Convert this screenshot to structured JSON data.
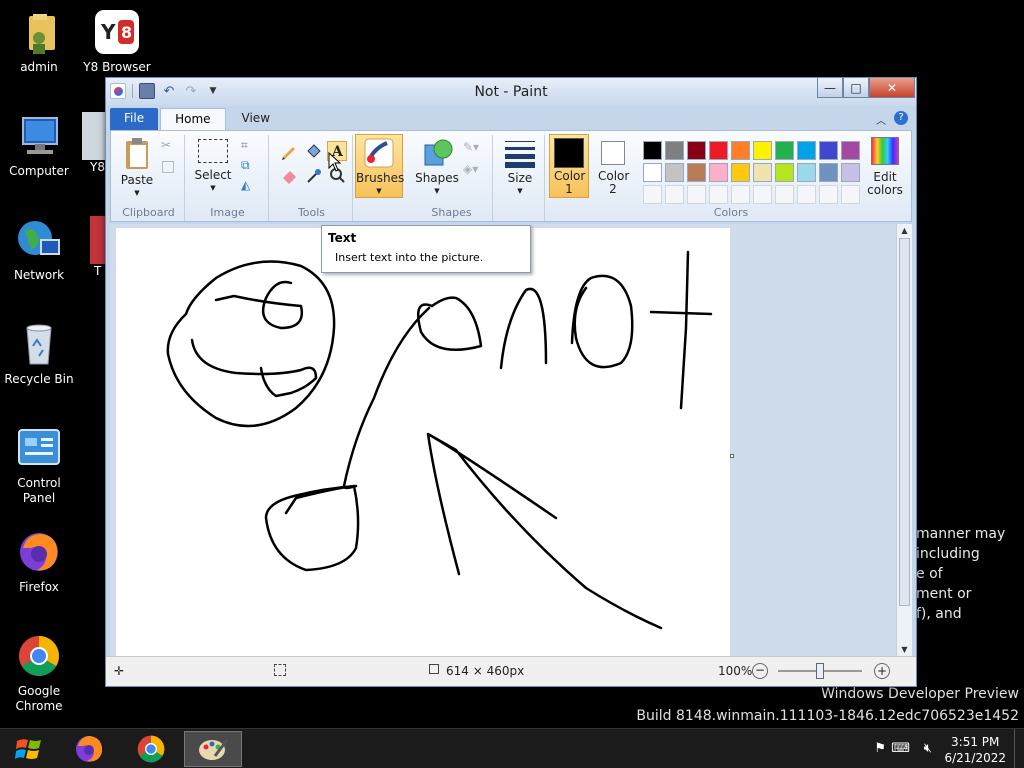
{
  "desktop": {
    "icons": [
      {
        "label": "admin",
        "icon": "user-folder-icon"
      },
      {
        "label": "Y8 Browser",
        "icon": "y8-browser-icon"
      },
      {
        "label": "Computer",
        "icon": "computer-icon"
      },
      {
        "label": "Network",
        "icon": "network-icon"
      },
      {
        "label": "Recycle Bin",
        "icon": "recycle-bin-icon"
      },
      {
        "label": "Control Panel",
        "icon": "control-panel-icon"
      },
      {
        "label": "Firefox",
        "icon": "firefox-icon"
      },
      {
        "label": "Google Chrome",
        "icon": "chrome-icon"
      }
    ],
    "partial_icon_labels": [
      "Y8",
      "T"
    ],
    "background_text": "manner may\nincluding\ne of\nment or\nf), and",
    "watermark": {
      "line1": "Windows Developer Preview",
      "line2": "Build 8148.winmain.111103-1846.12edc706523e1452"
    }
  },
  "window": {
    "title": "Not - Paint",
    "controls": {
      "minimize": "—",
      "maximize": "□",
      "close": "✕"
    },
    "tabs": [
      "File",
      "Home",
      "View"
    ],
    "ribbon": {
      "clipboard": {
        "label": "Clipboard",
        "paste": "Paste"
      },
      "image": {
        "label": "Image",
        "select": "Select"
      },
      "tools": {
        "label": "Tools"
      },
      "brushes": {
        "label": "Brushes"
      },
      "shapes": {
        "label": "Shapes",
        "shapes_btn": "Shapes"
      },
      "size": {
        "label": "Size"
      },
      "colors": {
        "label": "Colors",
        "color1": "Color 1",
        "color1_value": "#000000",
        "color2": "Color 2",
        "color2_value": "#ffffff",
        "edit": "Edit colors",
        "palette_row1": [
          "#000000",
          "#7f7f7f",
          "#880015",
          "#ed1c24",
          "#ff7f27",
          "#fff200",
          "#22b14c",
          "#00a2e8",
          "#3f48cc",
          "#a349a4"
        ],
        "palette_row2": [
          "#ffffff",
          "#c3c3c3",
          "#b97a57",
          "#ffaec9",
          "#ffc90e",
          "#efe4b0",
          "#b5e61d",
          "#99d9ea",
          "#7092be",
          "#c8bfe7"
        ]
      }
    },
    "tooltip": {
      "title": "Text",
      "description": "Insert text into the picture."
    },
    "status": {
      "dimensions": "614 × 460px",
      "zoom": "100%",
      "zoom_level": 0.5
    }
  },
  "taskbar": {
    "time": "3:51 PM",
    "date": "6/21/2022",
    "apps": [
      "start-orb-icon",
      "firefox-icon",
      "chrome-icon",
      "paint-icon"
    ]
  }
}
